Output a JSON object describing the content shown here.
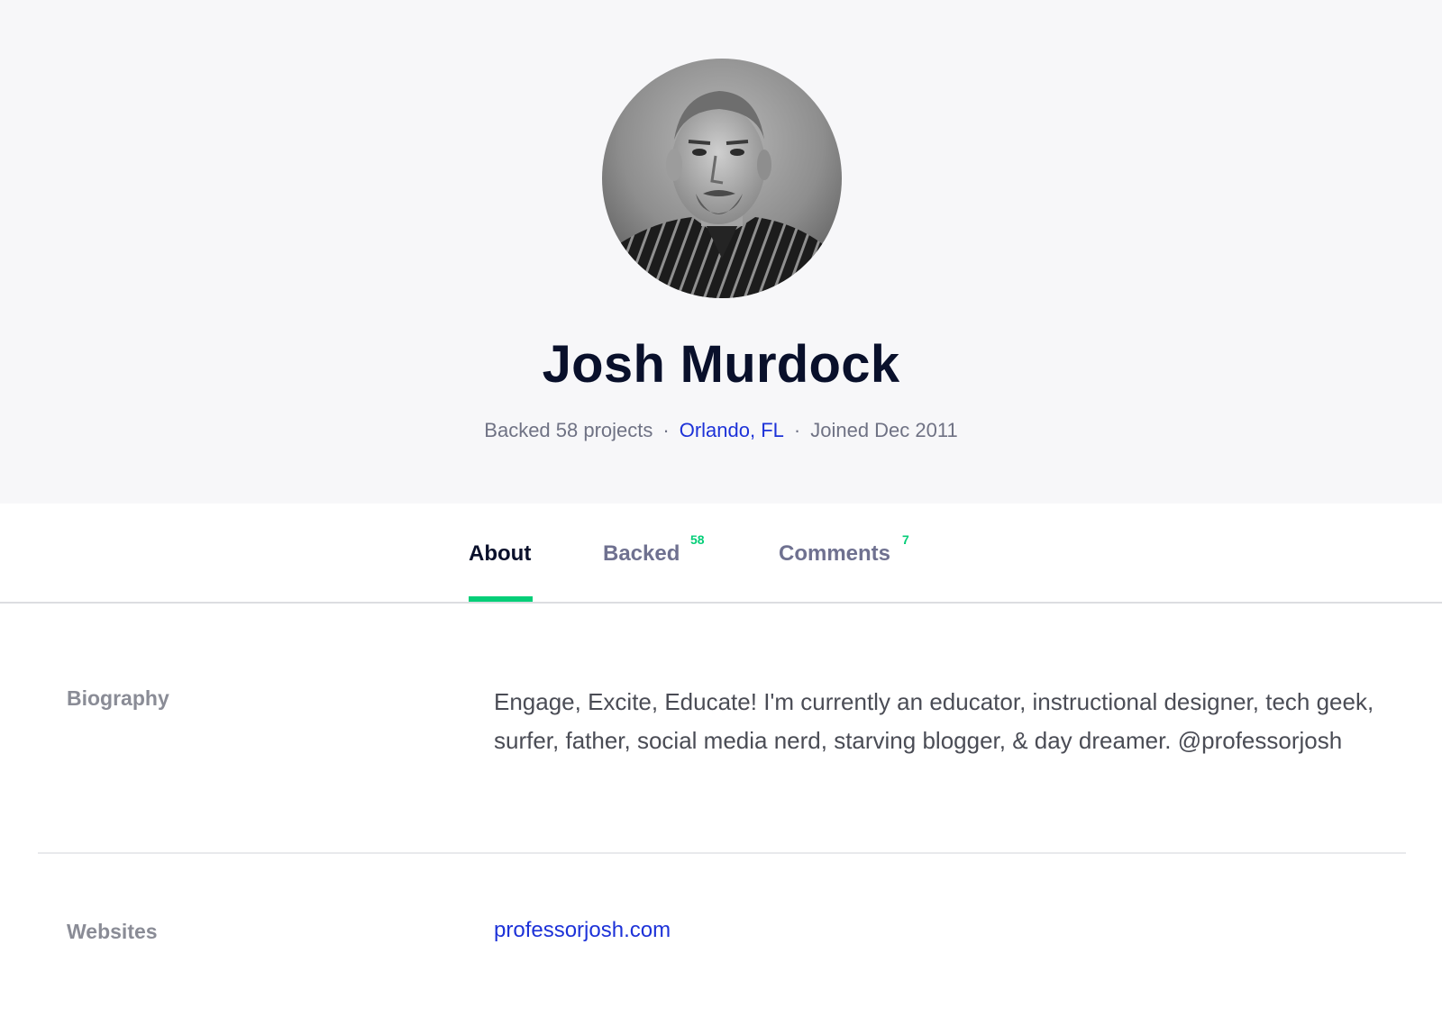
{
  "profile": {
    "name": "Josh Murdock",
    "backed_text": "Backed 58 projects",
    "location": "Orlando, FL",
    "joined": "Joined Dec 2011",
    "separator": "·",
    "avatar_icon": "profile-photo"
  },
  "tabs": [
    {
      "label": "About",
      "count": ""
    },
    {
      "label": "Backed",
      "count": "58"
    },
    {
      "label": "Comments",
      "count": "7"
    }
  ],
  "about": {
    "biography_label": "Biography",
    "biography_text": "Engage, Excite, Educate! I'm currently an educator, instructional designer, tech geek, surfer, father, social media nerd, starving blogger, & day dreamer. @professorjosh",
    "websites_label": "Websites",
    "website": "professorjosh.com"
  },
  "colors": {
    "accent": "#05ce78",
    "link": "#1d32d8",
    "heading": "#09102b",
    "hero_bg": "#f7f7f9"
  }
}
